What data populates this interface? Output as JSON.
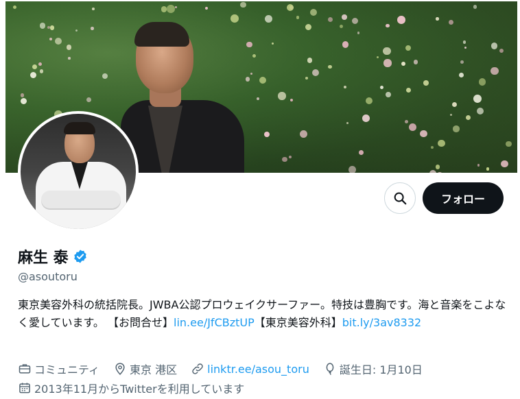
{
  "profile": {
    "name": "麻生 泰",
    "handle": "@asoutoru",
    "verified": true,
    "follow_label": "フォロー",
    "bio": {
      "part1": "東京美容外科の統括院長。JWBA公認プロウェイクサーファー。特技は豊胸です。海と音楽をこよなく愛しています。 【お問合せ】",
      "link1": "lin.ee/JfCBztUP",
      "part2": "【東京美容外科】",
      "link2": "bit.ly/3av8332"
    },
    "meta": {
      "category": "コミュニティ",
      "location": "東京 港区",
      "website": "linktr.ee/asou_toru",
      "birthday": "誕生日: 1月10日",
      "joined": "2013年11月からTwitterを利用しています"
    }
  },
  "icons": {
    "search": "search-icon",
    "verified": "verified-badge-icon",
    "briefcase": "briefcase-icon",
    "location": "location-pin-icon",
    "link": "link-icon",
    "balloon": "birthday-balloon-icon",
    "calendar": "calendar-icon"
  },
  "colors": {
    "accent": "#1d9bf0",
    "follow_bg": "#0f1419",
    "muted": "#536471"
  }
}
